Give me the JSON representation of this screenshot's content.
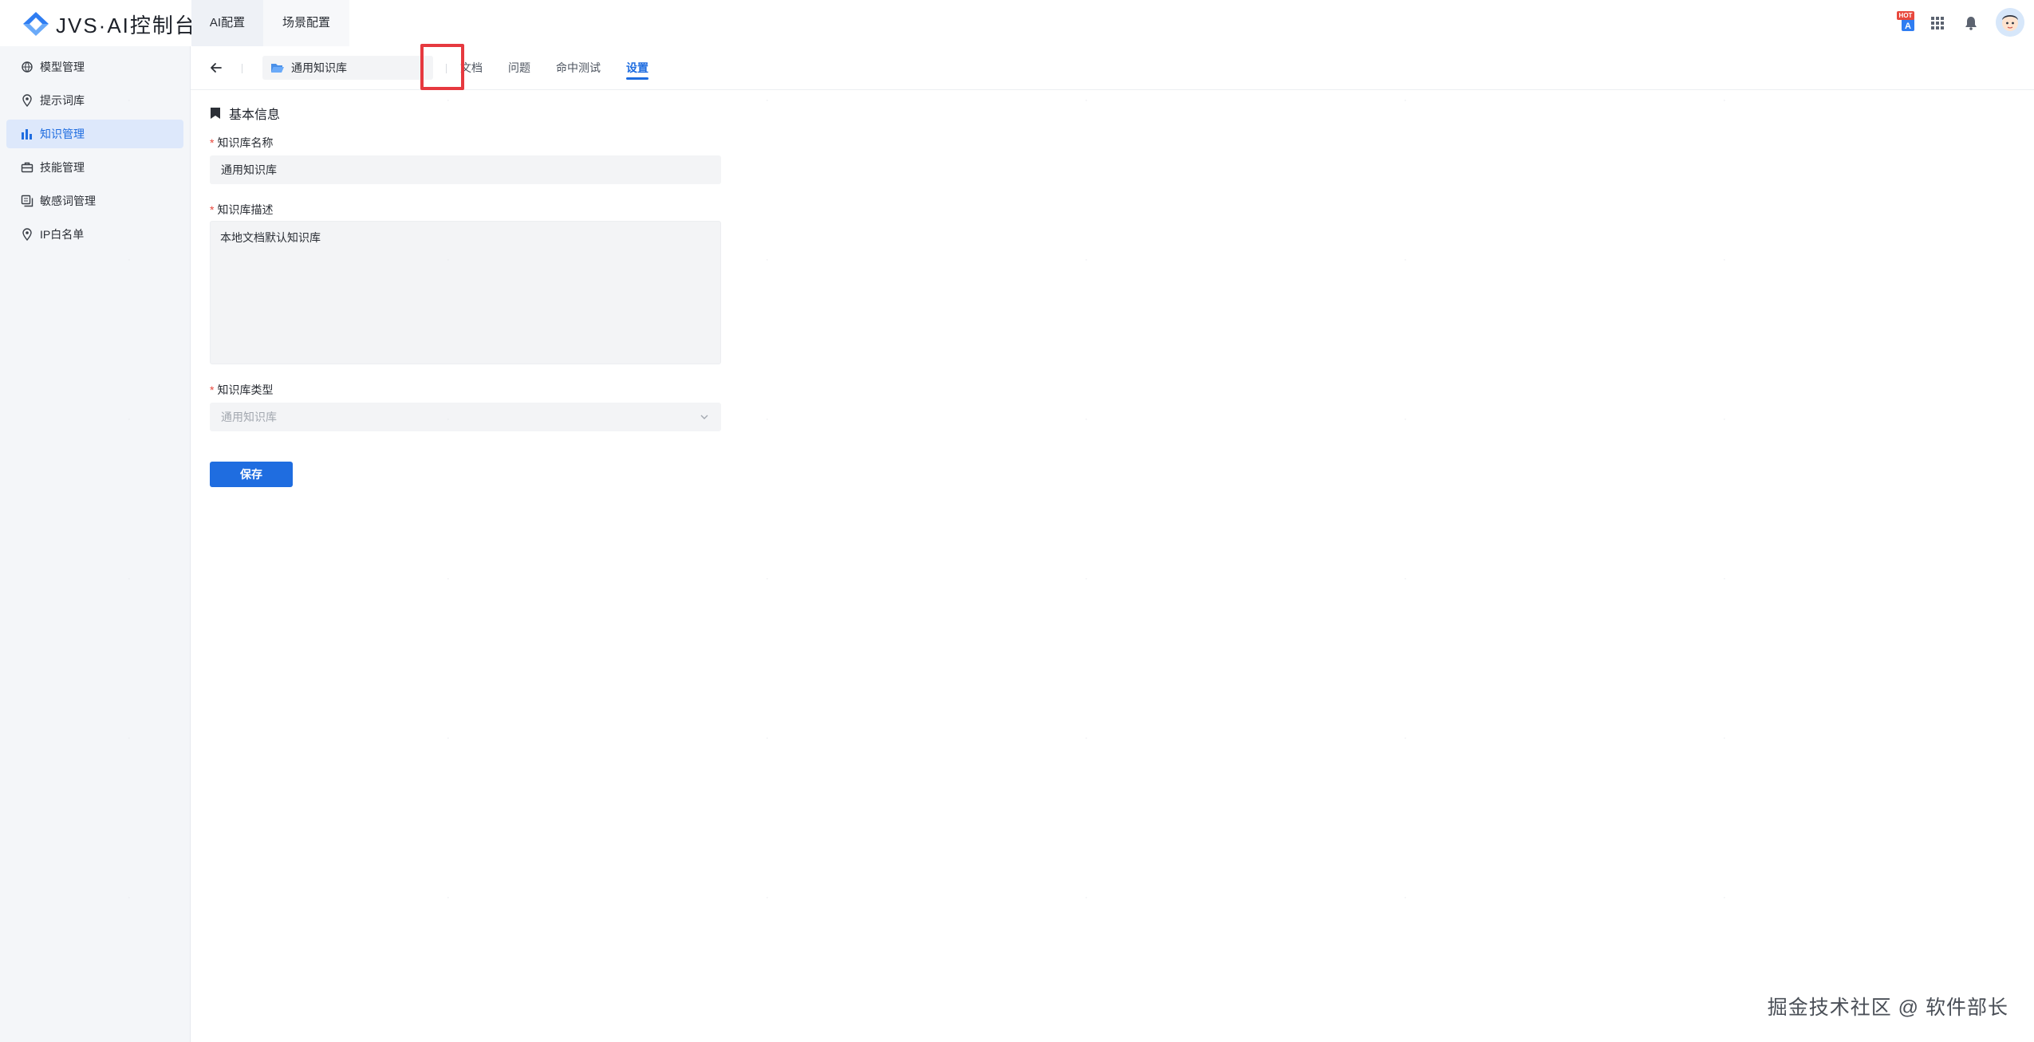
{
  "app": {
    "title": "JVS·AI控制台"
  },
  "top_tabs": [
    {
      "label": "AI配置"
    },
    {
      "label": "场景配置"
    }
  ],
  "top_right": {
    "hot_badge": "HOT"
  },
  "sidebar": {
    "items": [
      {
        "label": "模型管理",
        "icon": "model-icon"
      },
      {
        "label": "提示词库",
        "icon": "pin-icon"
      },
      {
        "label": "知识管理",
        "icon": "chart-icon",
        "active": true
      },
      {
        "label": "技能管理",
        "icon": "briefcase-icon"
      },
      {
        "label": "敏感词管理",
        "icon": "copy-icon"
      },
      {
        "label": "IP白名单",
        "icon": "pin-icon"
      }
    ]
  },
  "subnav": {
    "kb_name": "通用知识库",
    "tabs": [
      {
        "label": "文档"
      },
      {
        "label": "问题"
      },
      {
        "label": "命中测试"
      },
      {
        "label": "设置",
        "active": true
      }
    ]
  },
  "form": {
    "section_title": "基本信息",
    "name_label": "知识库名称",
    "name_value": "通用知识库",
    "desc_label": "知识库描述",
    "desc_value": "本地文档默认知识库",
    "type_label": "知识库类型",
    "type_value": "通用知识库",
    "save_label": "保存"
  },
  "footer": {
    "watermark": "掘金技术社区 @ 软件部长"
  },
  "colors": {
    "accent": "#1f6de0",
    "highlight": "#e6393f",
    "sidebar_bg": "#f4f6f9",
    "required": "#e8483d"
  }
}
